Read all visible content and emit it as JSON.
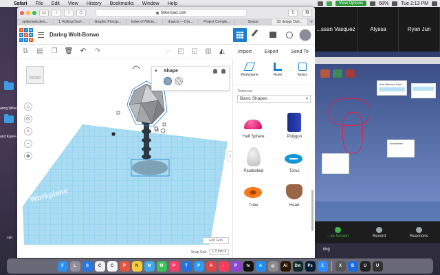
{
  "menubar": {
    "app": "Safari",
    "items": [
      "File",
      "Edit",
      "View",
      "History",
      "Bookmarks",
      "Window",
      "Help"
    ],
    "view_options": "View Options",
    "battery": "68%",
    "clock": "Tue 2:13 PM"
  },
  "browser": {
    "url": "tinkercad.com",
    "tabs": [
      "spiderweb.desi...",
      "1. Rolling Dice/...",
      "Graphic Princip...",
      "Index of /Winte...",
      "draw.io — Dra...",
      "Project Comple...",
      "Sessio",
      "3D design Darl..."
    ]
  },
  "tinkercad": {
    "logo_letters": [
      "TIN",
      "KER",
      "CAD"
    ],
    "design_title": "Daring Wolt-Borwo",
    "header_buttons": {
      "import": "Import",
      "export": "Export",
      "send_to": "Send To"
    },
    "viewcube_label": "FRONT",
    "shape_panel": {
      "title": "Shape"
    },
    "edit_grid": "Edit Grid",
    "snap_grid_label": "Snap Grid",
    "snap_grid_value": "1.0 mm ▾",
    "workplane_label": "Workplane",
    "library": {
      "tools": [
        {
          "label": "Workplane",
          "icon": "workplane-icon"
        },
        {
          "label": "Ruler",
          "icon": "ruler-icon"
        },
        {
          "label": "Notes",
          "icon": "notes-icon"
        }
      ],
      "source": "Tinkercad",
      "category": "Basic Shapes",
      "shapes": [
        {
          "label": "Half Sphere",
          "cls": "halfsphere"
        },
        {
          "label": "Polygon",
          "cls": "polygon"
        },
        {
          "label": "Paraboloid",
          "cls": "paraboloid"
        },
        {
          "label": "Torus",
          "cls": "torus"
        },
        {
          "label": "Tube",
          "cls": "tube"
        },
        {
          "label": "Heart",
          "cls": "heart"
        }
      ]
    }
  },
  "zoom": {
    "participants": [
      "...ssan Vasquez",
      "Alyssa",
      "Ryan Jun"
    ],
    "controls": {
      "share": "...ve Screen",
      "record": "Record",
      "reactions": "Reactions"
    },
    "bottom_label": "img",
    "slide_card_title": "Julie Belmont Wyn",
    "slide_card2_title": "Juanblaster"
  },
  "desktop": {
    "left_labels": [
      "aring Wilso",
      "and Kasi-F",
      "can"
    ]
  },
  "dock": {
    "apps": [
      {
        "letter": "F",
        "color": "#2d8ff0"
      },
      {
        "letter": "L",
        "color": "#8e8e9c"
      },
      {
        "letter": "S",
        "color": "#2579e6"
      },
      {
        "letter": "C",
        "color": "#f0f0f0"
      },
      {
        "letter": "C",
        "color": "#f6f6f6"
      },
      {
        "letter": "P",
        "color": "#e4553f"
      },
      {
        "letter": "N",
        "color": "#f7cd3c"
      },
      {
        "letter": "M",
        "color": "#3fa8ea"
      },
      {
        "letter": "M",
        "color": "#40c25a"
      },
      {
        "letter": "P",
        "color": "#f6406b"
      },
      {
        "letter": "T",
        "color": "#2470e0"
      },
      {
        "letter": "P",
        "color": "#2c9bf0"
      },
      {
        "letter": "A",
        "color": "#e14646"
      },
      {
        "letter": "♪",
        "color": "#fc3c5a"
      },
      {
        "letter": "P",
        "color": "#9243d8"
      },
      {
        "letter": "tv",
        "color": "#111111"
      },
      {
        "letter": "A",
        "color": "#1f8ff5"
      },
      {
        "letter": "⚙",
        "color": "#8a8a8a"
      },
      {
        "letter": "Ai",
        "color": "#2d1600"
      },
      {
        "letter": "Dw",
        "color": "#0e2b2b"
      },
      {
        "letter": "Ps",
        "color": "#001c33"
      },
      {
        "letter": "Z",
        "color": "#2d8cff"
      },
      {
        "letter": "X",
        "color": "#555555"
      },
      {
        "letter": "B",
        "color": "#1e6ad9"
      },
      {
        "letter": "U",
        "color": "#222222"
      },
      {
        "letter": "U",
        "color": "#333333"
      }
    ]
  },
  "colors": {
    "tinkercad_blue": "#1a7fd1",
    "grid_blue": "#8fd0ef",
    "selection_blue": "#1a7fd1",
    "zoom_green": "#3bb44a"
  }
}
